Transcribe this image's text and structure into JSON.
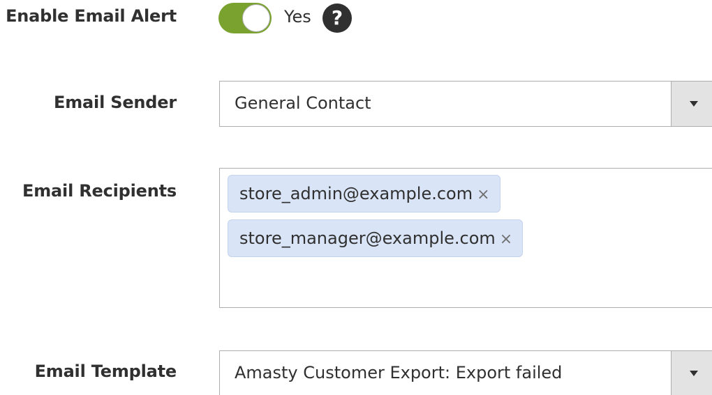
{
  "fields": {
    "enable_email_alert": {
      "label": "Enable Email Alert",
      "toggle_state": "on",
      "toggle_text": "Yes",
      "help_icon": "question-circle-icon",
      "help_glyph": "?"
    },
    "email_sender": {
      "label": "Email Sender",
      "selected": "General Contact"
    },
    "email_recipients": {
      "label": "Email Recipients",
      "tags": [
        {
          "text": "store_admin@example.com",
          "remove": "×"
        },
        {
          "text": "store_manager@example.com",
          "remove": "×"
        }
      ]
    },
    "email_template": {
      "label": "Email Template",
      "selected": "Amasty Customer Export: Export failed"
    }
  },
  "colors": {
    "toggle_on": "#79a22e",
    "tag_background": "#d9e4f7",
    "select_arrow_background": "#e3e3e3",
    "text": "#303030"
  }
}
